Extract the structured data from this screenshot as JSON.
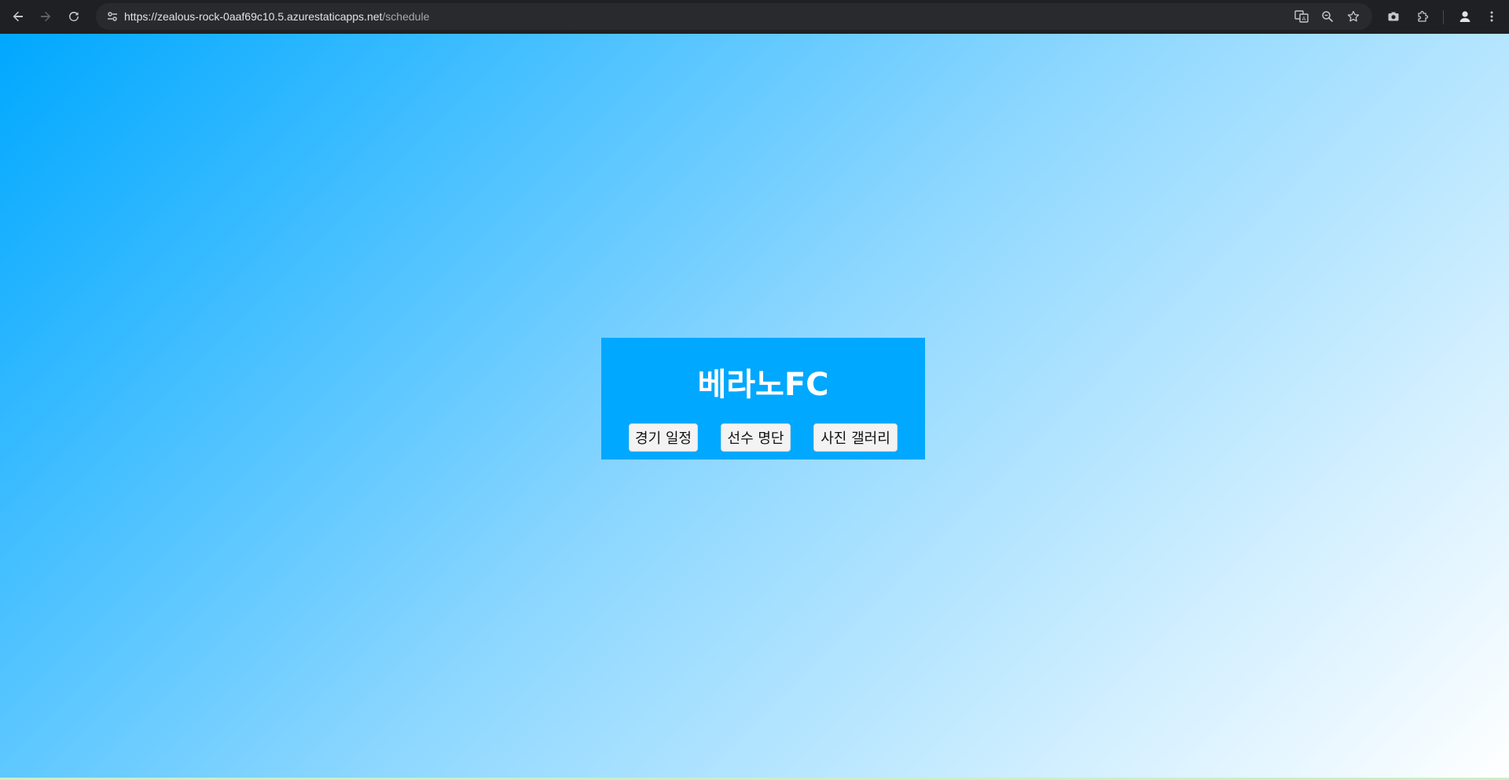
{
  "browser": {
    "url_host": "https://zealous-rock-0aaf69c10.5.azurestaticapps.net",
    "url_path": "/schedule",
    "icons": {
      "back": "back-arrow-icon",
      "forward": "forward-arrow-icon",
      "reload": "reload-icon",
      "site_info": "tune-icon",
      "translate": "translate-icon",
      "zoom": "zoom-icon",
      "bookmark": "star-icon",
      "screenshot": "camera-icon",
      "extensions": "puzzle-icon",
      "profile": "avatar-icon",
      "menu": "kebab-menu-icon"
    }
  },
  "page": {
    "title": "베라노FC",
    "nav": [
      {
        "label": "경기 일정"
      },
      {
        "label": "선수 명단"
      },
      {
        "label": "사진 갤러리"
      }
    ],
    "colors": {
      "card_bg": "#00a8ff",
      "gradient_start": "#00a8ff",
      "gradient_end": "#ffffff"
    }
  }
}
